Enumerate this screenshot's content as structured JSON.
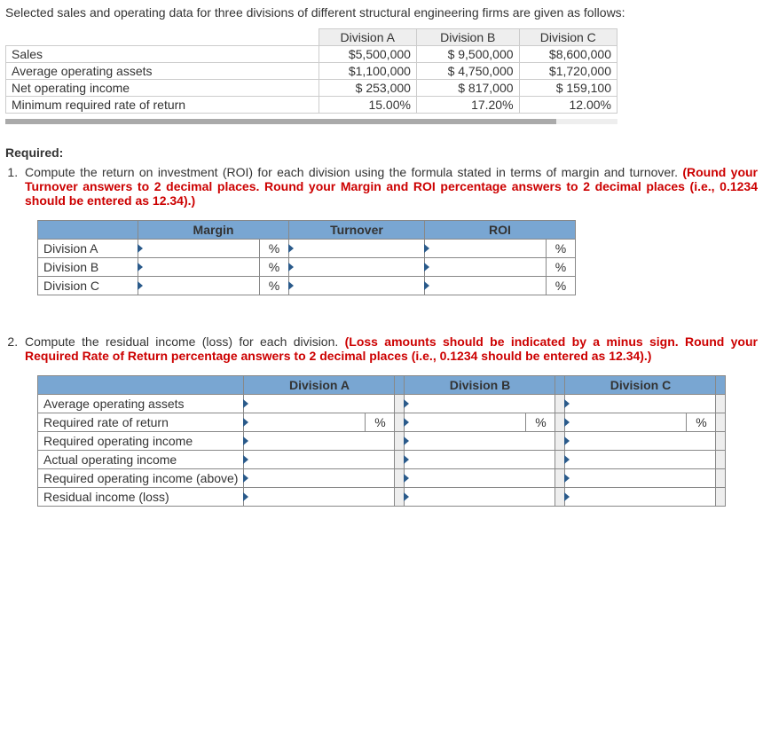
{
  "intro": "Selected sales and operating data for three divisions of different structural engineering firms are given as follows:",
  "data_table": {
    "headers": [
      "",
      "Division A",
      "Division B",
      "Division C"
    ],
    "rows": [
      {
        "label": "Sales",
        "a": "$5,500,000",
        "b": "$ 9,500,000",
        "c": "$8,600,000"
      },
      {
        "label": "Average operating assets",
        "a": "$1,100,000",
        "b": "$ 4,750,000",
        "c": "$1,720,000"
      },
      {
        "label": "Net operating income",
        "a": "$   253,000",
        "b": "$    817,000",
        "c": "$   159,100"
      },
      {
        "label": "Minimum required rate of return",
        "a": "15.00%",
        "b": "17.20%",
        "c": "12.00%"
      }
    ]
  },
  "required_label": "Required:",
  "q1": {
    "text_plain": "Compute the return on investment (ROI) for each division using the formula stated in terms of margin and turnover. ",
    "text_red": "(Round your Turnover answers to 2 decimal places. Round your Margin and ROI percentage answers to 2 decimal places (i.e., 0.1234 should be entered as 12.34).)",
    "table": {
      "headers": [
        "",
        "Margin",
        "",
        "Turnover",
        "ROI",
        ""
      ],
      "rows": [
        "Division A",
        "Division B",
        "Division C"
      ],
      "unit_margin": "%",
      "unit_roi": "%"
    }
  },
  "q2": {
    "text_plain": "Compute the residual income (loss) for each division. ",
    "text_red": "(Loss amounts should be indicated by a minus sign. Round your Required Rate of Return percentage answers to 2 decimal places (i.e., 0.1234 should be entered as 12.34).)",
    "table": {
      "cols": [
        "Division A",
        "Division B",
        "Division C"
      ],
      "rows": [
        "Average operating assets",
        "Required rate of return",
        "Required operating income",
        "Actual operating income",
        "Required operating income (above)",
        "Residual income (loss)"
      ],
      "unit_rate": "%"
    }
  }
}
